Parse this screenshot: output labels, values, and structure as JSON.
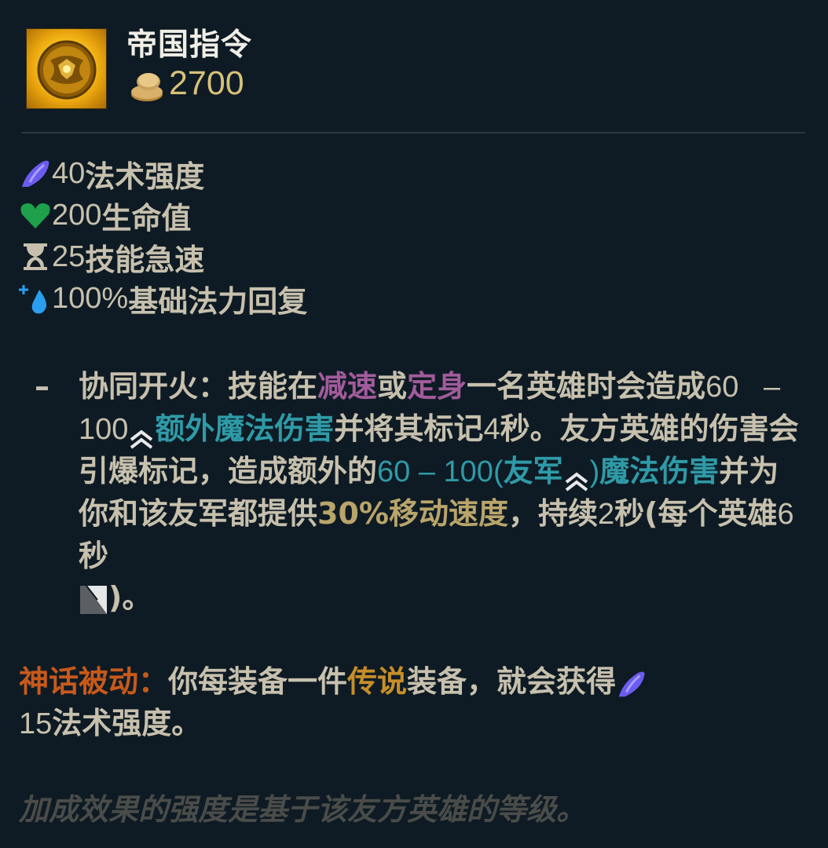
{
  "item": {
    "name": "帝国指令",
    "cost": "2700",
    "icon": "golden-orb-icon"
  },
  "stats": [
    {
      "value": "40",
      "label": "法术强度",
      "icon": "ability-power-icon",
      "color": "#6b5cf0"
    },
    {
      "value": "200",
      "label": "生命值",
      "icon": "health-heart-icon",
      "color": "#1fa04a"
    },
    {
      "value": "25",
      "label": "技能急速",
      "icon": "hourglass-icon",
      "color": "#c7c0ad"
    },
    {
      "value": "100%",
      "label": "基础法力回复",
      "icon": "mana-regen-icon",
      "color": "#2a9ff0"
    }
  ],
  "passive": {
    "dash": "–",
    "name": "协同开火：",
    "t1": "技能在",
    "slow": "减速",
    "t2": "或",
    "immobilize": "定身",
    "t3": "一名英雄时会造成",
    "n1": "60",
    "sep1": "   –    ",
    "n2": "100",
    "dmg1": "额外魔法伤害",
    "t4": "并将其标记",
    "n3": "4",
    "t5": "秒。友方英雄的伤害会引爆标记，造成额外的",
    "dmg2_num": "60 – 100",
    "dmg2_open": "(",
    "ally": "友军",
    "dmg2_close": ")",
    "dmg2_text": "魔法伤害",
    "t6": "并为你和该友军都提供",
    "ms": "30%移动速度",
    "t7": "，持续",
    "n4": "2",
    "t8": "秒(每个英雄",
    "n5": "6",
    "t9": "秒",
    "t10": ")。"
  },
  "mythic": {
    "label": "神话被动：",
    "t1": "你每装备一件",
    "legendary": "传说",
    "t2": "装备，就会获得",
    "n": "15",
    "t3": "法术强度。"
  },
  "footnote": "加成效果的强度是基于该友方英雄的等级。",
  "colors": {
    "background": "#0e1b24",
    "text": "#c7c0ad",
    "magenta": "#a25b9b",
    "teal": "#2f9aa7",
    "olive": "#b9a46a",
    "orange": "#c8591b",
    "gold": "#c78e28",
    "cost": "#d8c07a"
  }
}
